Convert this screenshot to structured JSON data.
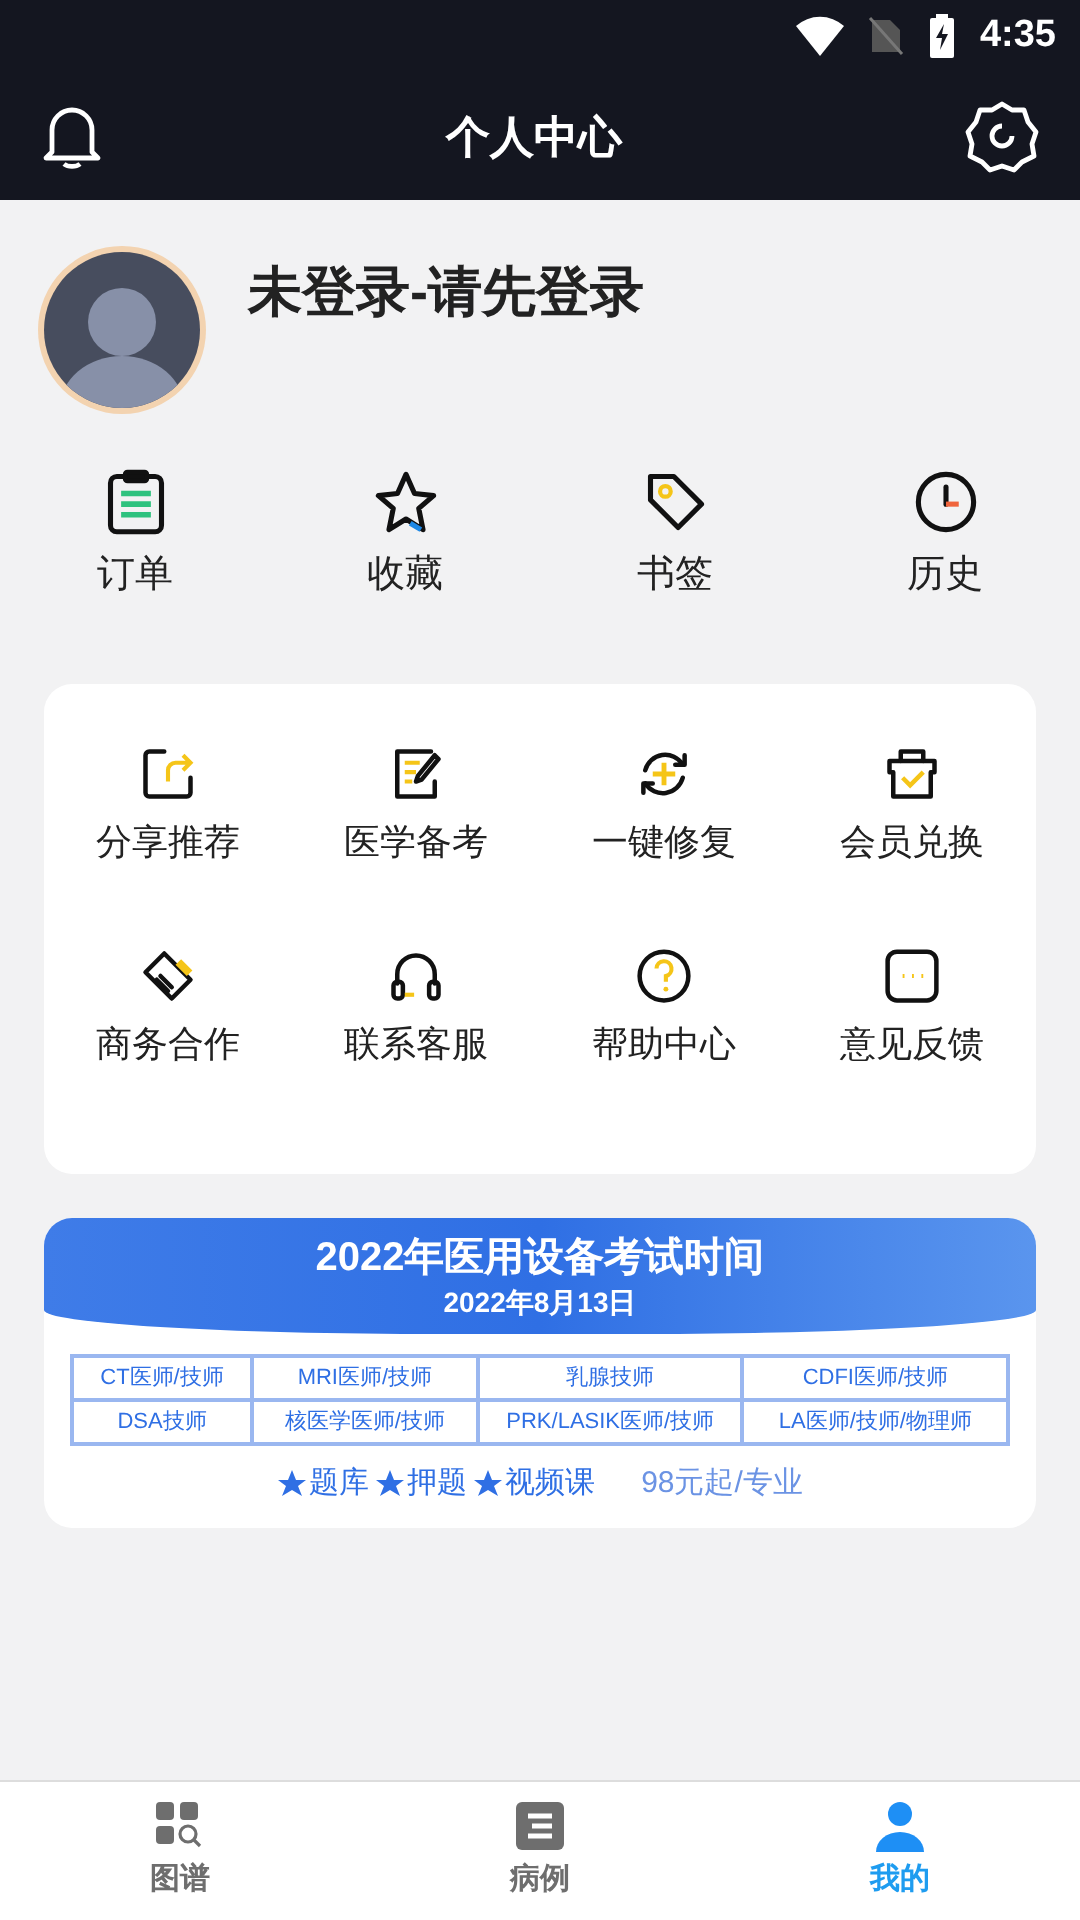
{
  "status_bar": {
    "time": "4:35"
  },
  "header": {
    "title": "个人中心"
  },
  "profile": {
    "name": "未登录-请先登录"
  },
  "quick_links": [
    {
      "label": "订单"
    },
    {
      "label": "收藏"
    },
    {
      "label": "书签"
    },
    {
      "label": "历史"
    }
  ],
  "services": [
    {
      "label": "分享推荐"
    },
    {
      "label": "医学备考"
    },
    {
      "label": "一键修复"
    },
    {
      "label": "会员兑换"
    },
    {
      "label": "商务合作"
    },
    {
      "label": "联系客服"
    },
    {
      "label": "帮助中心"
    },
    {
      "label": "意见反馈"
    }
  ],
  "banner": {
    "title": "2022年医用设备考试时间",
    "date": "2022年8月13日",
    "table": [
      [
        "CT医师/技师",
        "MRI医师/技师",
        "乳腺技师",
        "CDFI医师/技师"
      ],
      [
        "DSA技师",
        "核医学医师/技师",
        "PRK/LASIK医师/技师",
        "LA医师/技师/物理师"
      ]
    ],
    "features": [
      "题库",
      "押题",
      "视频课"
    ],
    "price": "98元起/专业"
  },
  "tabs": [
    {
      "label": "图谱",
      "selected": false
    },
    {
      "label": "病例",
      "selected": false
    },
    {
      "label": "我的",
      "selected": true
    }
  ]
}
